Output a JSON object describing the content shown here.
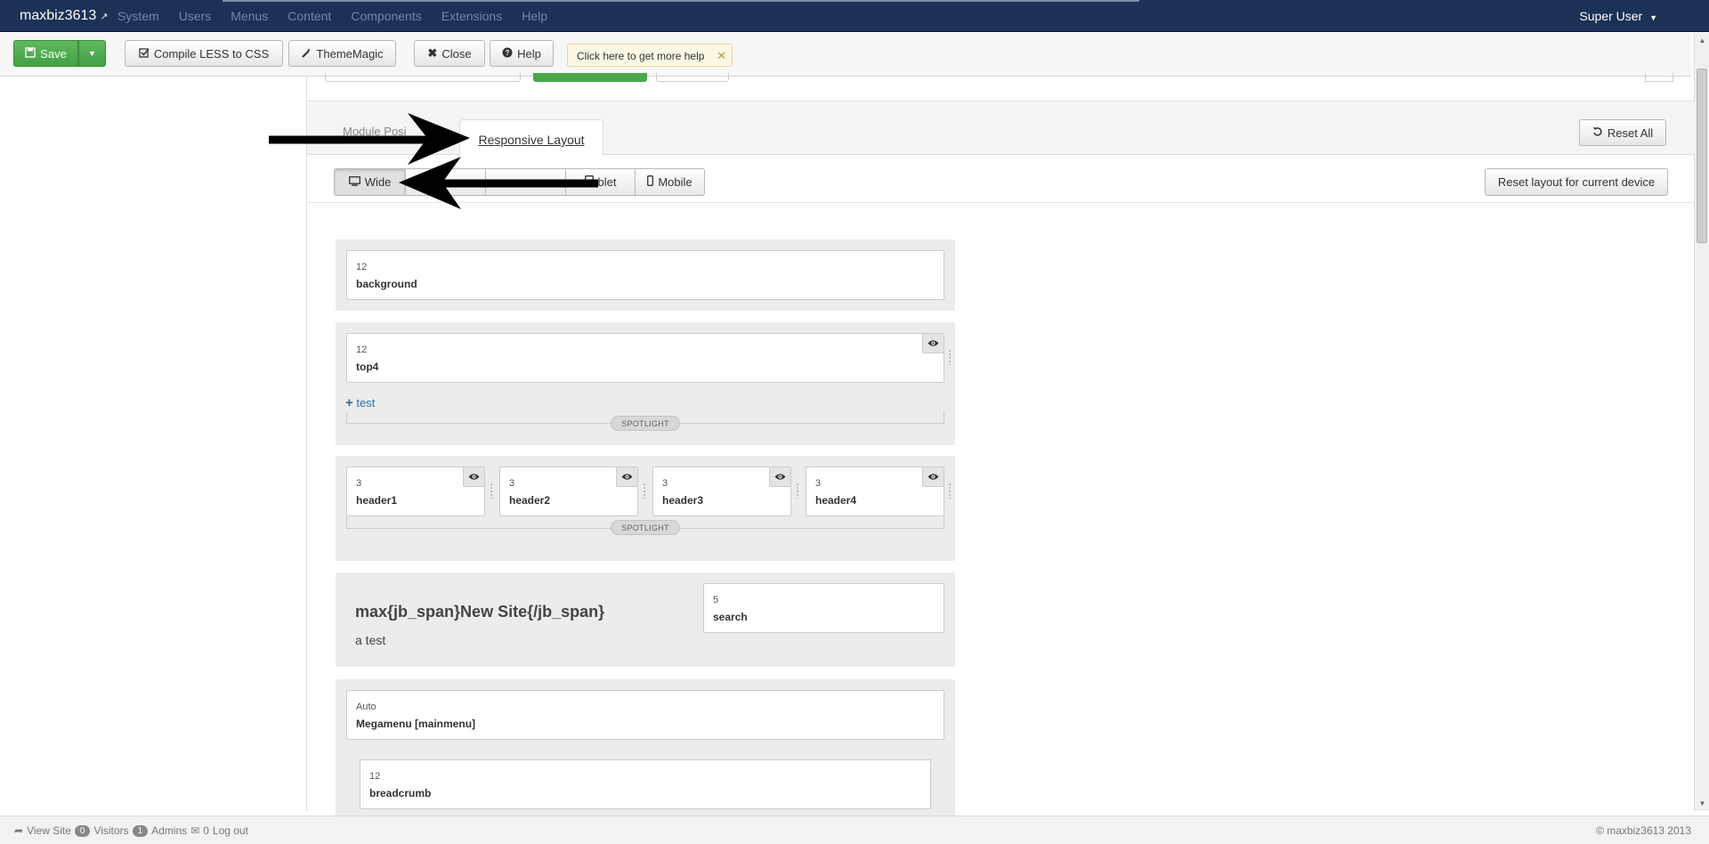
{
  "navbar": {
    "brand": "maxbiz3613",
    "menu": [
      "System",
      "Users",
      "Menus",
      "Content",
      "Components",
      "Extensions",
      "Help"
    ],
    "user": "Super User"
  },
  "toolbar": {
    "save": "Save",
    "compile": "Compile LESS to CSS",
    "thememagic": "ThemeMagic",
    "close": "Close",
    "help": "Help",
    "tip": "Click here to get more help"
  },
  "tabs": {
    "inactive": "Module Posi",
    "active": "Responsive Layout",
    "reset_all": "Reset All"
  },
  "devices": {
    "items": [
      "Wide",
      "",
      "",
      "blet",
      "Mobile"
    ],
    "reset": "Reset layout for current device"
  },
  "rows": {
    "background": {
      "span": "12",
      "name": "background"
    },
    "top4": {
      "span": "12",
      "name": "top4",
      "add": "test",
      "spotlight": "SPOTLIGHT"
    },
    "headers": {
      "spotlight": "SPOTLIGHT",
      "items": [
        {
          "span": "3",
          "name": "header1"
        },
        {
          "span": "3",
          "name": "header2"
        },
        {
          "span": "3",
          "name": "header3"
        },
        {
          "span": "3",
          "name": "header4"
        }
      ]
    },
    "site": {
      "title": "max{jb_span}New Site{/jb_span}",
      "desc": "a test",
      "search_span": "5",
      "search_name": "search"
    },
    "megamenu": {
      "span": "Auto",
      "name": "Megamenu [mainmenu]"
    },
    "breadcrumb": {
      "span": "12",
      "name": "breadcrumb"
    }
  },
  "footer": {
    "view_site": "View Site",
    "visitors_count": "0",
    "visitors": "Visitors",
    "admins_count": "1",
    "admins": "Admins",
    "messages_count": "0",
    "logout": "Log out",
    "copyright": "© maxbiz3613 2013"
  }
}
